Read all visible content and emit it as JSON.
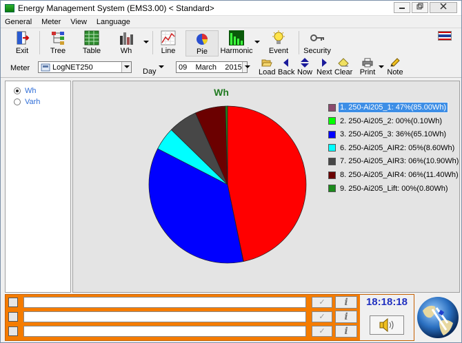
{
  "window": {
    "title": "Energy Management System (EMS3.00) < Standard>"
  },
  "menu": [
    "General",
    "Meter",
    "View",
    "Language"
  ],
  "toolbar": {
    "exit": "Exit",
    "tree": "Tree",
    "table": "Table",
    "wh": "Wh",
    "line": "Line",
    "pie": "Pie",
    "harmonic": "Harmonic",
    "event": "Event",
    "security": "Security"
  },
  "row2": {
    "meter_label": "Meter",
    "meter_value": "LogNET250",
    "period": "Day",
    "date_day": "09",
    "date_month": "March",
    "date_year": "2015",
    "load": "Load",
    "back": "Back",
    "now": "Now",
    "next": "Next",
    "clear": "Clear",
    "print": "Print",
    "note": "Note"
  },
  "left_panel": {
    "options": [
      {
        "label": "Wh",
        "checked": true
      },
      {
        "label": "Varh",
        "checked": false
      }
    ]
  },
  "chart_data": {
    "type": "pie",
    "title": "Wh",
    "legend_position": "right",
    "slices": [
      {
        "label": "1. 250-Ai205_1: 47%(85.00Wh)",
        "value": 85.0,
        "color": "#ff0000",
        "swatch": "#8b4a6e",
        "selected": true
      },
      {
        "label": "2. 250-Ai205_2: 00%(0.10Wh)",
        "value": 0.1,
        "color": "#00ff00",
        "swatch": "#00ff00",
        "selected": false
      },
      {
        "label": "3. 250-Ai205_3: 36%(65.10Wh)",
        "value": 65.1,
        "color": "#0000ff",
        "swatch": "#0000ff",
        "selected": false
      },
      {
        "label": "6. 250-Ai205_AIR2: 05%(8.60Wh)",
        "value": 8.6,
        "color": "#00ffff",
        "swatch": "#00ffff",
        "selected": false
      },
      {
        "label": "7. 250-Ai205_AIR3: 06%(10.90Wh)",
        "value": 10.9,
        "color": "#474747",
        "swatch": "#474747",
        "selected": false
      },
      {
        "label": "8. 250-Ai205_AIR4: 06%(11.40Wh)",
        "value": 11.4,
        "color": "#6b0000",
        "swatch": "#6b0000",
        "selected": false
      },
      {
        "label": "9. 250-Ai205_Lift: 00%(0.80Wh)",
        "value": 0.8,
        "color": "#1c8a1c",
        "swatch": "#1c8a1c",
        "selected": false
      }
    ]
  },
  "status": {
    "check_glyph": "✓",
    "info_glyph": "i",
    "clock": "18:18:18"
  }
}
